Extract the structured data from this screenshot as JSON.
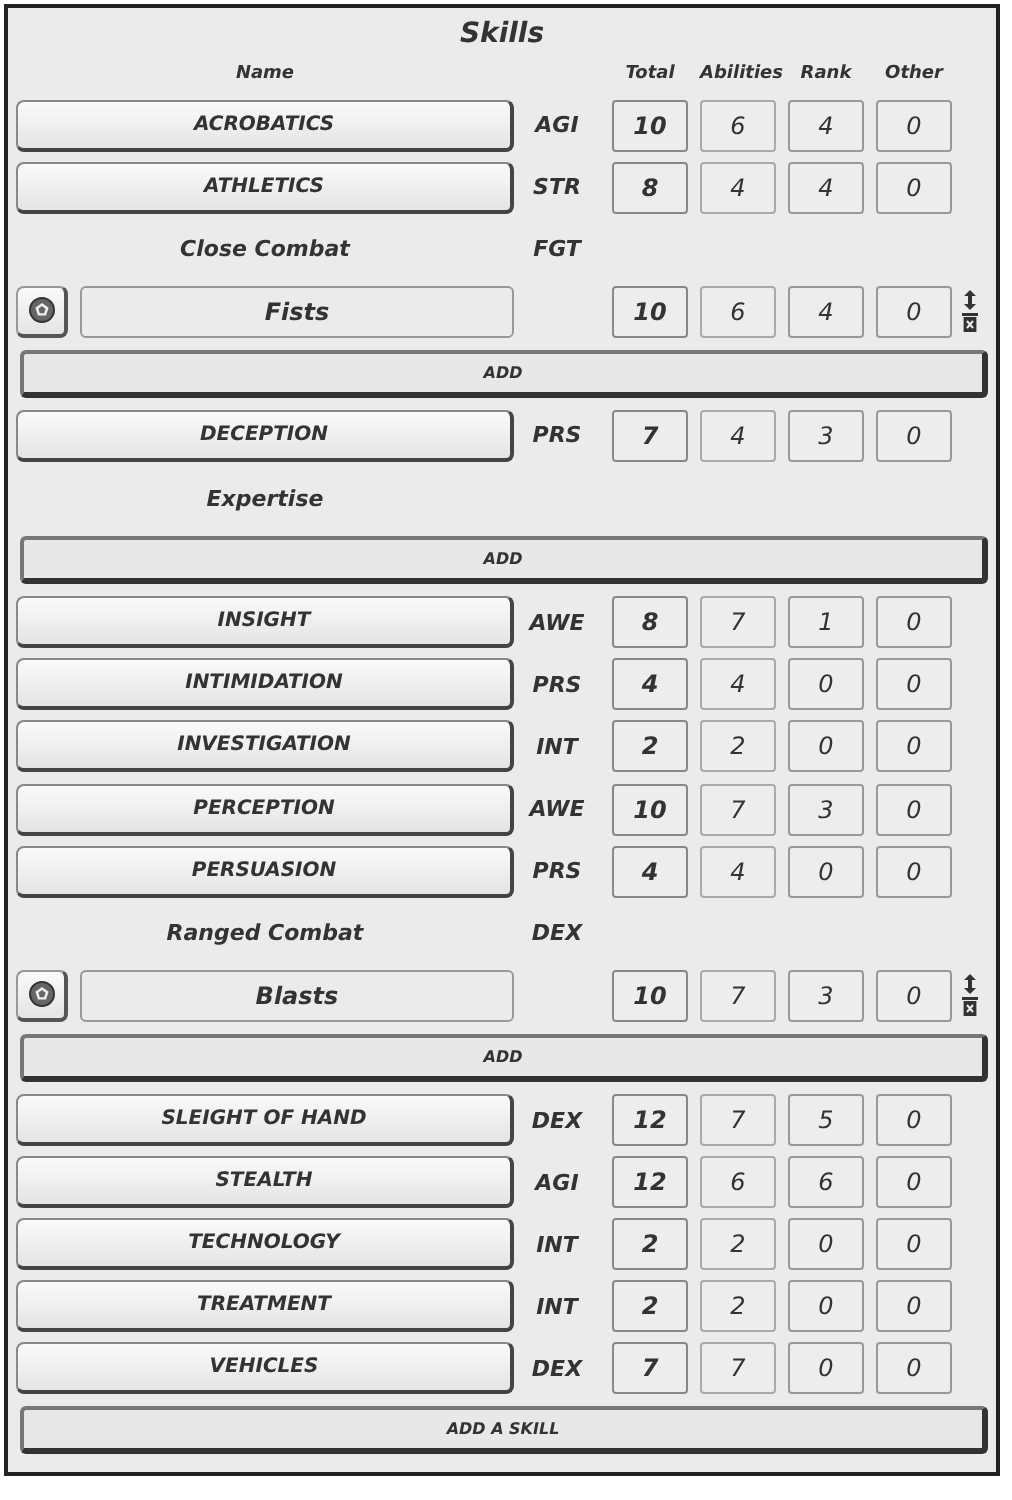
{
  "title": "Skills",
  "columns": {
    "name": "Name",
    "total": "Total",
    "abilities": "Abilities",
    "rank": "Rank",
    "other": "Other"
  },
  "rows": [
    {
      "kind": "skill",
      "name": "ACROBATICS",
      "ability": "AGI",
      "total": "10",
      "abilities": "6",
      "rank": "4",
      "other": "0"
    },
    {
      "kind": "skill",
      "name": "ATHLETICS",
      "ability": "STR",
      "total": "8",
      "abilities": "4",
      "rank": "4",
      "other": "0"
    },
    {
      "kind": "group",
      "name": "Close Combat",
      "ability": "FGT",
      "add": "ADD",
      "items": [
        {
          "name": "Fists",
          "total": "10",
          "abilities": "6",
          "rank": "4",
          "other": "0"
        }
      ]
    },
    {
      "kind": "skill",
      "name": "DECEPTION",
      "ability": "PRS",
      "total": "7",
      "abilities": "4",
      "rank": "3",
      "other": "0"
    },
    {
      "kind": "group",
      "name": "Expertise",
      "add": "ADD",
      "items": []
    },
    {
      "kind": "skill",
      "name": "INSIGHT",
      "ability": "AWE",
      "total": "8",
      "abilities": "7",
      "rank": "1",
      "other": "0"
    },
    {
      "kind": "skill",
      "name": "INTIMIDATION",
      "ability": "PRS",
      "total": "4",
      "abilities": "4",
      "rank": "0",
      "other": "0"
    },
    {
      "kind": "skill",
      "name": "INVESTIGATION",
      "ability": "INT",
      "total": "2",
      "abilities": "2",
      "rank": "0",
      "other": "0"
    },
    {
      "kind": "skill",
      "name": "PERCEPTION",
      "ability": "AWE",
      "total": "10",
      "abilities": "7",
      "rank": "3",
      "other": "0"
    },
    {
      "kind": "skill",
      "name": "PERSUASION",
      "ability": "PRS",
      "total": "4",
      "abilities": "4",
      "rank": "0",
      "other": "0"
    },
    {
      "kind": "group",
      "name": "Ranged Combat",
      "ability": "DEX",
      "add": "ADD",
      "items": [
        {
          "name": "Blasts",
          "total": "10",
          "abilities": "7",
          "rank": "3",
          "other": "0"
        }
      ]
    },
    {
      "kind": "skill",
      "name": "SLEIGHT OF HAND",
      "ability": "DEX",
      "total": "12",
      "abilities": "7",
      "rank": "5",
      "other": "0"
    },
    {
      "kind": "skill",
      "name": "STEALTH",
      "ability": "AGI",
      "total": "12",
      "abilities": "6",
      "rank": "6",
      "other": "0"
    },
    {
      "kind": "skill",
      "name": "TECHNOLOGY",
      "ability": "INT",
      "total": "2",
      "abilities": "2",
      "rank": "0",
      "other": "0"
    },
    {
      "kind": "skill",
      "name": "TREATMENT",
      "ability": "INT",
      "total": "2",
      "abilities": "2",
      "rank": "0",
      "other": "0"
    },
    {
      "kind": "skill",
      "name": "VEHICLES",
      "ability": "DEX",
      "total": "7",
      "abilities": "7",
      "rank": "0",
      "other": "0"
    }
  ],
  "add_skill": "ADD A SKILL"
}
